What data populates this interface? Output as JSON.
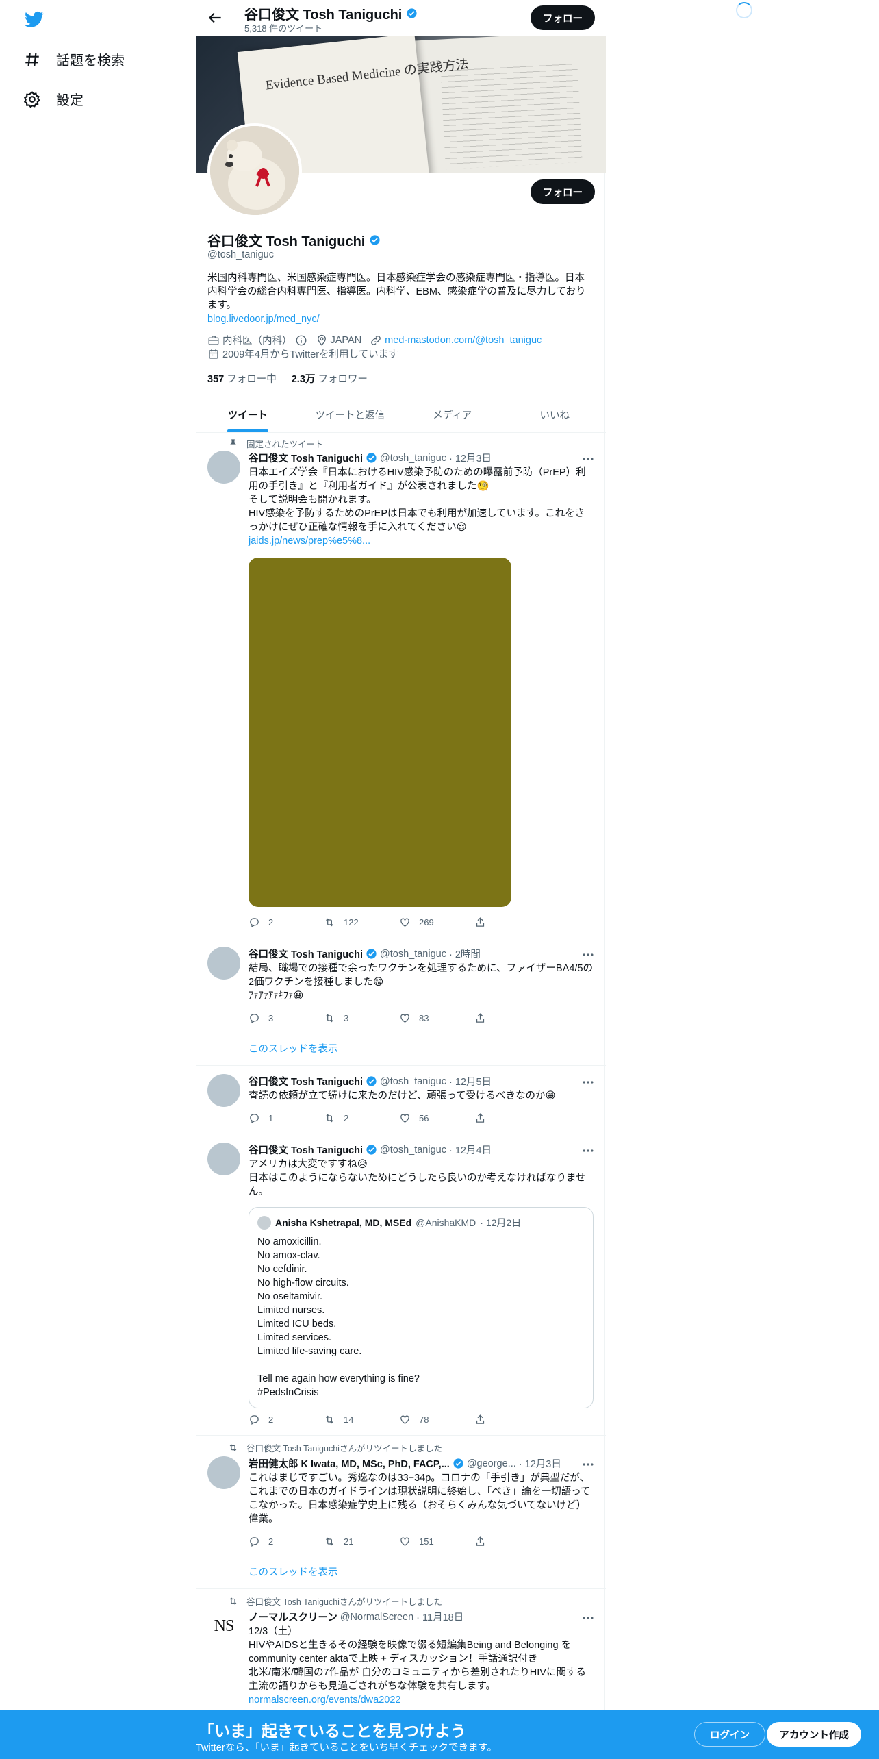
{
  "sidebar": {
    "explore_label": "話題を検索",
    "settings_label": "設定"
  },
  "topbar": {
    "name": "谷口俊文 Tosh Taniguchi",
    "tweet_count": "5,318 件のツイート",
    "follow_label": "フォロー"
  },
  "profile": {
    "banner_title": "Evidence Based Medicine の実践方法",
    "follow_label": "フォロー",
    "name": "谷口俊文 Tosh Taniguchi",
    "handle": "@tosh_taniguc",
    "bio": "米国内科専門医、米国感染症専門医。日本感染症学会の感染症専門医・指導医。日本内科学会の総合内科専門医、指導医。内科学、EBM、感染症学の普及に尽力しております。",
    "bio_link": "blog.livedoor.jp/med_nyc/",
    "category": "内科医（内科）",
    "location": "JAPAN",
    "url": "med-mastodon.com/@tosh_taniguc",
    "joined": "2009年4月からTwitterを利用しています",
    "following_count": "357",
    "following_label": "フォロー中",
    "followers_count": "2.3万",
    "followers_label": "フォロワー"
  },
  "tabs": [
    "ツイート",
    "ツイートと返信",
    "メディア",
    "いいね"
  ],
  "tweets": [
    {
      "context": "固定されたツイート",
      "name": "谷口俊文 Tosh Taniguchi",
      "handle": "@tosh_taniguc",
      "time": "· 12月3日",
      "text1": "日本エイズ学会『日本におけるHIV感染予防のための曝露前予防（PrEP）利用の手引き』と『利用者ガイド』が公表されました🧐",
      "text2": "そして説明会も開かれます。",
      "text3": "HIV感染を予防するためのPrEPは日本でも利用が加速しています。これをきっかけにぜひ正確な情報を手に入れてください😌",
      "link": "jaids.jp/news/prep%e5%8...",
      "media_color": "#7c7416",
      "replies": "2",
      "retweets": "122",
      "likes": "269"
    },
    {
      "name": "谷口俊文 Tosh Taniguchi",
      "handle": "@tosh_taniguc",
      "time": "· 2時間",
      "text1": "結局、職場での接種で余ったワクチンを処理するために、ファイザーBA4/5の2価ワクチンを接種しました😁",
      "text2": "ｱｧｱｧｱｧｷﾌｧ😀",
      "show_thread": "このスレッドを表示",
      "replies": "3",
      "retweets": "3",
      "likes": "83"
    },
    {
      "name": "谷口俊文 Tosh Taniguchi",
      "handle": "@tosh_taniguc",
      "time": "· 12月5日",
      "text1": "査読の依頼が立て続けに来たのだけど、頑張って受けるべきなのか😁",
      "replies": "1",
      "retweets": "2",
      "likes": "56"
    },
    {
      "name": "谷口俊文 Tosh Taniguchi",
      "handle": "@tosh_taniguc",
      "time": "· 12月4日",
      "text1": "アメリカは大変ですすね😥",
      "text2": "日本はこのようにならないためにどうしたら良いのか考えなければなりません。",
      "quote": {
        "name": "Anisha Kshetrapal, MD, MSEd",
        "handle": "@AnishaKMD",
        "time": "· 12月2日",
        "lines": [
          "No amoxicillin.",
          "No amox-clav.",
          "No cefdinir.",
          "No high-flow circuits.",
          "No oseltamivir.",
          "Limited nurses.",
          "Limited ICU beds.",
          "Limited services.",
          "Limited life-saving care.",
          "",
          "Tell me again how everything is fine?",
          "#PedsInCrisis"
        ]
      },
      "replies": "2",
      "retweets": "14",
      "likes": "78"
    },
    {
      "context": "谷口俊文 Tosh Taniguchiさんがリツイートしました",
      "name": "岩田健太郎 K Iwata, MD, MSc, PhD, FACP,...",
      "handle": "@george...",
      "time": "· 12月3日",
      "text1": "これはまじですごい。秀逸なのは33−34p。コロナの「手引き」が典型だが、これまでの日本のガイドラインは現状説明に終始し、「べき」論を一切語ってこなかった。日本感染症学史上に残る（おそらくみんな気づいてないけど）偉業。",
      "show_thread": "このスレッドを表示",
      "replies": "2",
      "retweets": "21",
      "likes": "151"
    },
    {
      "context": "谷口俊文 Tosh Taniguchiさんがリツイートしました",
      "name": "ノーマルスクリーン",
      "handle": "@NormalScreen",
      "time": "· 11月18日",
      "avatar_text": "NS",
      "text1": "12/3（土）",
      "text2": "HIVやAIDSと生きるその経験を映像で綴る短編集Being and Belonging をcommunity center aktaで上映 + ディスカッション！手話通訳付き",
      "text3": "北米/南米/韓国の7作品が 自分のコミュニティから差別されたりHIVに関する主流の語りからも見過ごされがちな体験を共有します。",
      "link": "normalscreen.org/events/dwa2022"
    }
  ],
  "bottom_bar": {
    "title": "「いま」起きていることを見つけよう",
    "subtitle": "Twitterなら、「いま」起きていることをいち早くチェックできます。",
    "login": "ログイン",
    "signup": "アカウント作成"
  },
  "colors": {
    "accent": "#1d9bf0",
    "text": "#0f1419",
    "muted": "#536471"
  }
}
